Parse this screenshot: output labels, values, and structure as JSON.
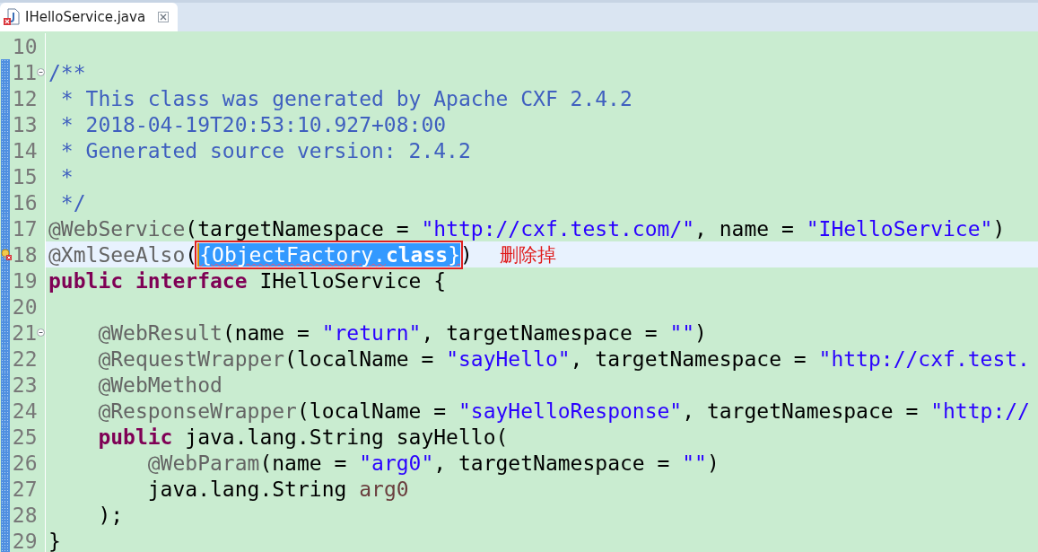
{
  "tab": {
    "label": "IHelloService.java",
    "selected": true
  },
  "lines": [
    {
      "number": "10",
      "changed": false,
      "current": false,
      "fold": false,
      "marker": false
    },
    {
      "number": "11",
      "changed": true,
      "current": false,
      "fold": true,
      "marker": false,
      "tokens": [
        {
          "kind": "comment",
          "text": "/**"
        }
      ]
    },
    {
      "number": "12",
      "changed": true,
      "current": false,
      "fold": false,
      "marker": false,
      "tokens": [
        {
          "kind": "comment",
          "text": " * This class was generated by Apache CXF 2.4.2"
        }
      ]
    },
    {
      "number": "13",
      "changed": true,
      "current": false,
      "fold": false,
      "marker": false,
      "tokens": [
        {
          "kind": "comment",
          "text": " * 2018-04-19T20:53:10.927+08:00"
        }
      ]
    },
    {
      "number": "14",
      "changed": true,
      "current": false,
      "fold": false,
      "marker": false,
      "tokens": [
        {
          "kind": "comment",
          "text": " * Generated source version: 2.4.2"
        }
      ]
    },
    {
      "number": "15",
      "changed": true,
      "current": false,
      "fold": false,
      "marker": false,
      "tokens": [
        {
          "kind": "comment",
          "text": " *"
        }
      ]
    },
    {
      "number": "16",
      "changed": true,
      "current": false,
      "fold": false,
      "marker": false,
      "tokens": [
        {
          "kind": "comment",
          "text": " */"
        }
      ]
    },
    {
      "number": "17",
      "changed": true,
      "current": false,
      "fold": false,
      "marker": false,
      "tokens": [
        {
          "kind": "annotation",
          "text": "@WebService"
        },
        {
          "kind": "plain",
          "text": "(targetNamespace = "
        },
        {
          "kind": "string",
          "text": "\"http://cxf.test.com/\""
        },
        {
          "kind": "plain",
          "text": ", name = "
        },
        {
          "kind": "string",
          "text": "\"IHelloService\""
        },
        {
          "kind": "plain",
          "text": ")"
        }
      ]
    },
    {
      "number": "18",
      "changed": true,
      "current": true,
      "fold": false,
      "marker": true,
      "note": "删除掉",
      "tokens": [
        {
          "kind": "annotation",
          "text": "@XmlSeeAlso"
        },
        {
          "kind": "plain",
          "text": "("
        },
        {
          "kind": "boxed",
          "parts": [
            {
              "kind": "selected",
              "text": "{ObjectFactory."
            },
            {
              "kind": "selected-keyword",
              "text": "class"
            },
            {
              "kind": "selected",
              "text": "}"
            }
          ]
        },
        {
          "kind": "plain",
          "text": ")"
        }
      ]
    },
    {
      "number": "19",
      "changed": true,
      "current": false,
      "fold": false,
      "marker": false,
      "tokens": [
        {
          "kind": "keyword",
          "text": "public"
        },
        {
          "kind": "keyword",
          "text": " interface"
        },
        {
          "kind": "plain",
          "text": " IHelloService {"
        }
      ]
    },
    {
      "number": "20",
      "changed": true,
      "current": false,
      "fold": false,
      "marker": false
    },
    {
      "number": "21",
      "changed": true,
      "current": false,
      "fold": true,
      "marker": false,
      "tokens": [
        {
          "kind": "annotation",
          "text": "    @WebResult"
        },
        {
          "kind": "plain",
          "text": "(name = "
        },
        {
          "kind": "string",
          "text": "\"return\""
        },
        {
          "kind": "plain",
          "text": ", targetNamespace = "
        },
        {
          "kind": "string",
          "text": "\"\""
        },
        {
          "kind": "plain",
          "text": ")"
        }
      ]
    },
    {
      "number": "22",
      "changed": true,
      "current": false,
      "fold": false,
      "marker": false,
      "tokens": [
        {
          "kind": "annotation",
          "text": "    @RequestWrapper"
        },
        {
          "kind": "plain",
          "text": "(localName = "
        },
        {
          "kind": "string",
          "text": "\"sayHello\""
        },
        {
          "kind": "plain",
          "text": ", targetNamespace = "
        },
        {
          "kind": "string",
          "text": "\"http://cxf.test."
        }
      ]
    },
    {
      "number": "23",
      "changed": true,
      "current": false,
      "fold": false,
      "marker": false,
      "tokens": [
        {
          "kind": "annotation",
          "text": "    @WebMethod"
        }
      ]
    },
    {
      "number": "24",
      "changed": true,
      "current": false,
      "fold": false,
      "marker": false,
      "tokens": [
        {
          "kind": "annotation",
          "text": "    @ResponseWrapper"
        },
        {
          "kind": "plain",
          "text": "(localName = "
        },
        {
          "kind": "string",
          "text": "\"sayHelloResponse\""
        },
        {
          "kind": "plain",
          "text": ", targetNamespace = "
        },
        {
          "kind": "string",
          "text": "\"http://"
        }
      ]
    },
    {
      "number": "25",
      "changed": true,
      "current": false,
      "fold": false,
      "marker": false,
      "tokens": [
        {
          "kind": "keyword",
          "text": "    public"
        },
        {
          "kind": "plain",
          "text": " java.lang.String sayHello("
        }
      ]
    },
    {
      "number": "26",
      "changed": true,
      "current": false,
      "fold": false,
      "marker": false,
      "tokens": [
        {
          "kind": "annotation",
          "text": "        @WebParam"
        },
        {
          "kind": "plain",
          "text": "(name = "
        },
        {
          "kind": "string",
          "text": "\"arg0\""
        },
        {
          "kind": "plain",
          "text": ", targetNamespace = "
        },
        {
          "kind": "string",
          "text": "\"\""
        },
        {
          "kind": "plain",
          "text": ")"
        }
      ]
    },
    {
      "number": "27",
      "changed": true,
      "current": false,
      "fold": false,
      "marker": false,
      "tokens": [
        {
          "kind": "plain",
          "text": "        java.lang.String "
        },
        {
          "kind": "param",
          "text": "arg0"
        }
      ]
    },
    {
      "number": "28",
      "changed": true,
      "current": false,
      "fold": false,
      "marker": false,
      "tokens": [
        {
          "kind": "plain",
          "text": "    );"
        }
      ]
    },
    {
      "number": "29",
      "changed": true,
      "current": false,
      "fold": false,
      "marker": false,
      "tokens": [
        {
          "kind": "plain",
          "text": "}"
        }
      ]
    }
  ]
}
